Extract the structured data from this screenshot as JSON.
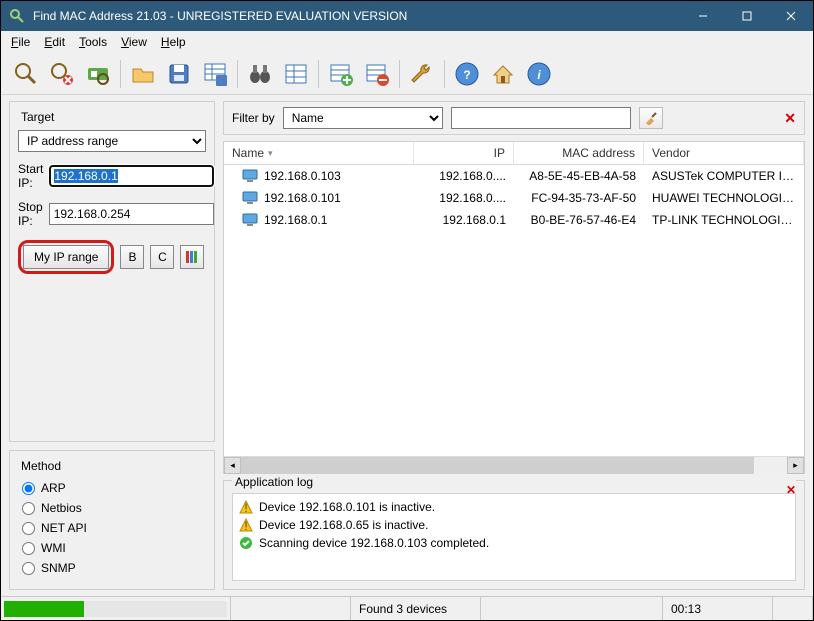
{
  "title": "Find MAC Address 21.03 - UNREGISTERED EVALUATION VERSION",
  "menu": {
    "file": "File",
    "edit": "Edit",
    "tools": "Tools",
    "view": "View",
    "help": "Help"
  },
  "target": {
    "legend": "Target",
    "mode": "IP address range",
    "start_label": "Start IP:",
    "start_value": "192.168.0.1",
    "stop_label": "Stop IP:",
    "stop_value": "192.168.0.254",
    "myrange_label": "My IP range",
    "b_label": "B",
    "c_label": "C"
  },
  "method": {
    "legend": "Method",
    "options": [
      "ARP",
      "Netbios",
      "NET API",
      "WMI",
      "SNMP"
    ],
    "selected": "ARP"
  },
  "filter": {
    "label": "Filter by",
    "field": "Name",
    "value": ""
  },
  "columns": {
    "name": "Name",
    "ip": "IP",
    "mac": "MAC address",
    "vendor": "Vendor"
  },
  "rows": [
    {
      "name": "192.168.0.103",
      "ip": "192.168.0....",
      "mac": "A8-5E-45-EB-4A-58",
      "vendor": "ASUSTek COMPUTER INC."
    },
    {
      "name": "192.168.0.101",
      "ip": "192.168.0....",
      "mac": "FC-94-35-73-AF-50",
      "vendor": "HUAWEI TECHNOLOGIES CO.,LTI"
    },
    {
      "name": "192.168.0.1",
      "ip": "192.168.0.1",
      "mac": "B0-BE-76-57-46-E4",
      "vendor": "TP-LINK TECHNOLOGIES CO.,LTI"
    }
  ],
  "log": {
    "legend": "Application log",
    "lines": [
      {
        "icon": "warn",
        "text": "Device 192.168.0.101 is inactive."
      },
      {
        "icon": "warn",
        "text": "Device 192.168.0.65 is inactive."
      },
      {
        "icon": "ok",
        "text": "Scanning device 192.168.0.103 completed."
      }
    ]
  },
  "status": {
    "found": "Found 3 devices",
    "time": "00:13"
  },
  "icons": {
    "monitor": "monitor-icon",
    "warn": "warning-icon",
    "ok": "check-icon"
  },
  "colors": {
    "accent": "#2d5a7a",
    "highlight": "#d21a1a",
    "progress": "#22b000"
  }
}
